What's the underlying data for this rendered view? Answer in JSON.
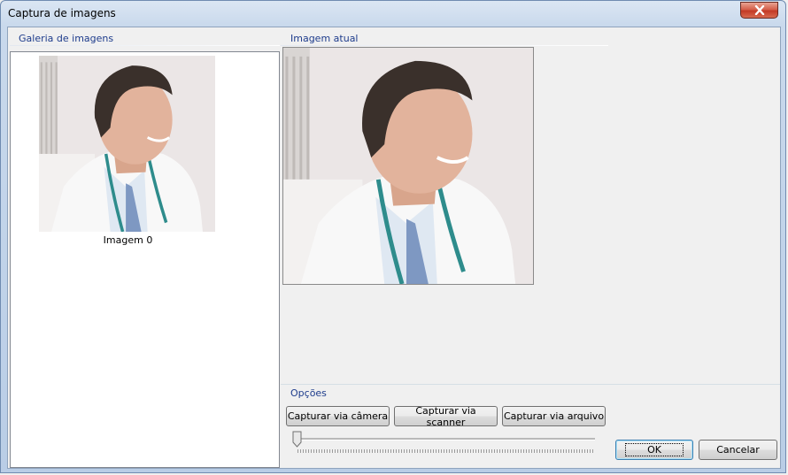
{
  "window": {
    "title": "Captura de imagens"
  },
  "gallery": {
    "header": "Galeria de imagens",
    "items": [
      {
        "caption": "Imagem 0"
      }
    ]
  },
  "current": {
    "header": "Imagem atual"
  },
  "options": {
    "header": "Opções",
    "buttons": {
      "camera": "Capturar via câmera",
      "scanner": "Capturar via scanner",
      "file": "Capturar via arquivo"
    },
    "slider_value": 0
  },
  "dialog_buttons": {
    "ok": "OK",
    "cancel": "Cancelar"
  },
  "icons": {
    "close": "close-icon"
  },
  "colors": {
    "group_header_text": "#1e3c8c",
    "close_button": "#c33a25"
  }
}
